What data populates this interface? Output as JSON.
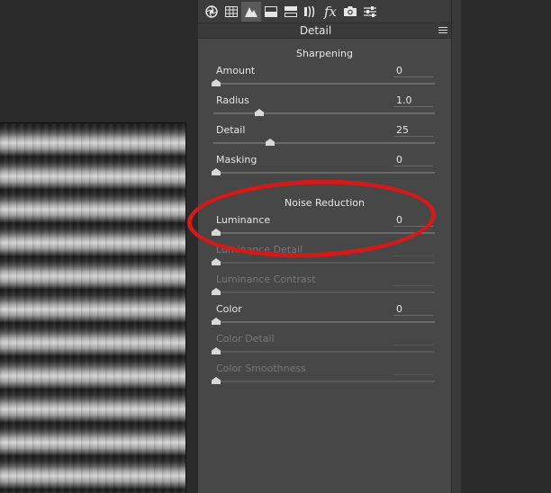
{
  "toolbar": {
    "icons": [
      "aperture-icon",
      "grid-icon",
      "detail-triangle-icon",
      "split-tone-icon",
      "hsl-icon",
      "lens-icon",
      "fx-icon",
      "camera-icon",
      "presets-sliders-icon"
    ],
    "fx_label": "fx"
  },
  "panel": {
    "title": "Detail"
  },
  "sharpening": {
    "title": "Sharpening",
    "sliders": [
      {
        "label": "Amount",
        "value": "0",
        "level": 0
      },
      {
        "label": "Radius",
        "value": "1.0",
        "level": 0.2
      },
      {
        "label": "Detail",
        "value": "25",
        "level": 0.25
      },
      {
        "label": "Masking",
        "value": "0",
        "level": 0
      }
    ]
  },
  "noise_reduction": {
    "title": "Noise Reduction",
    "sliders": [
      {
        "label": "Luminance",
        "value": "0",
        "level": 0,
        "enabled": true
      },
      {
        "label": "Luminance Detail",
        "value": "",
        "level": 0,
        "enabled": false
      },
      {
        "label": "Luminance Contrast",
        "value": "",
        "level": 0,
        "enabled": false
      },
      {
        "label": "Color",
        "value": "0",
        "level": 0,
        "enabled": true
      },
      {
        "label": "Color Detail",
        "value": "",
        "level": 0,
        "enabled": false
      },
      {
        "label": "Color Smoothness",
        "value": "",
        "level": 0,
        "enabled": false
      }
    ]
  },
  "colors": {
    "panel_bg": "#474747",
    "annotation": "#d21a1a"
  }
}
